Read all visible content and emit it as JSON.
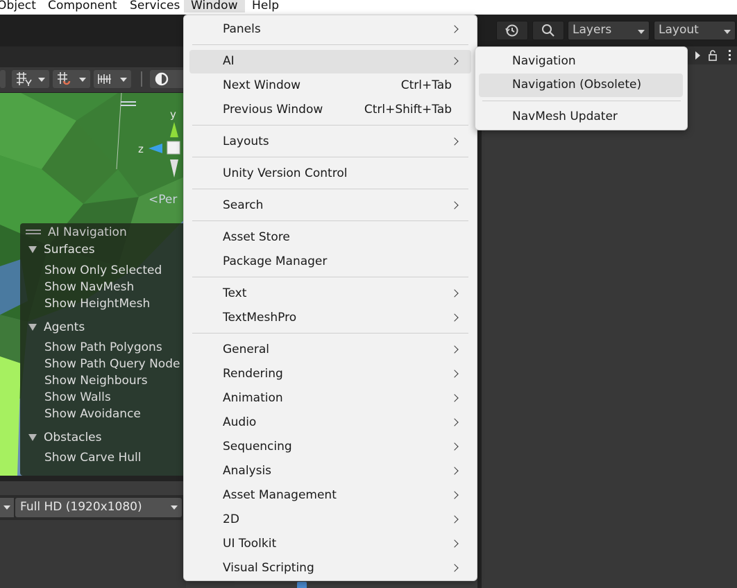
{
  "menubar": {
    "items": [
      "Object",
      "Component",
      "Services",
      "Window",
      "Help"
    ]
  },
  "toolbar": {
    "layers_label": "Layers",
    "layout_label": "Layout",
    "icons": [
      "history-icon",
      "search-icon"
    ]
  },
  "scene": {
    "gizmo": {
      "y_label": "y",
      "z_label": "z",
      "persp_label": "Per"
    },
    "ai_navigation": {
      "title": "AI Navigation",
      "surfaces": {
        "label": "Surfaces",
        "options": [
          "Show Only Selected",
          "Show NavMesh",
          "Show HeightMesh"
        ]
      },
      "agents": {
        "label": "Agents",
        "options": [
          "Show Path Polygons",
          "Show Path Query Node",
          "Show Neighbours",
          "Show Walls",
          "Show Avoidance"
        ]
      },
      "obstacles": {
        "label": "Obstacles",
        "options": [
          "Show Carve Hull"
        ]
      }
    }
  },
  "game": {
    "resolution": "Full HD (1920x1080)"
  },
  "window_menu": {
    "items": [
      {
        "label": "Panels",
        "submenu": true
      },
      {
        "label": "AI",
        "submenu": true,
        "highlighted": true
      },
      {
        "label": "Next Window",
        "shortcut": "Ctrl+Tab"
      },
      {
        "label": "Previous Window",
        "shortcut": "Ctrl+Shift+Tab"
      },
      {
        "label": "Layouts",
        "submenu": true
      },
      {
        "label": "Unity Version Control"
      },
      {
        "label": "Search",
        "submenu": true
      },
      {
        "label": "Asset Store"
      },
      {
        "label": "Package Manager"
      },
      {
        "label": "Text",
        "submenu": true
      },
      {
        "label": "TextMeshPro",
        "submenu": true
      },
      {
        "label": "General",
        "submenu": true
      },
      {
        "label": "Rendering",
        "submenu": true
      },
      {
        "label": "Animation",
        "submenu": true
      },
      {
        "label": "Audio",
        "submenu": true
      },
      {
        "label": "Sequencing",
        "submenu": true
      },
      {
        "label": "Analysis",
        "submenu": true
      },
      {
        "label": "Asset Management",
        "submenu": true
      },
      {
        "label": "2D",
        "submenu": true
      },
      {
        "label": "UI Toolkit",
        "submenu": true
      },
      {
        "label": "Visual Scripting",
        "submenu": true
      }
    ]
  },
  "ai_submenu": {
    "items": [
      {
        "label": "Navigation"
      },
      {
        "label": "Navigation (Obsolete)",
        "highlighted": true
      },
      {
        "label": "NavMesh Updater"
      }
    ]
  },
  "colors": {
    "menu_bg": "#f2f2f2",
    "menu_highlight": "#e1e1e1",
    "editor_dark": "#383838",
    "overlay_bg": "#212f1d"
  }
}
